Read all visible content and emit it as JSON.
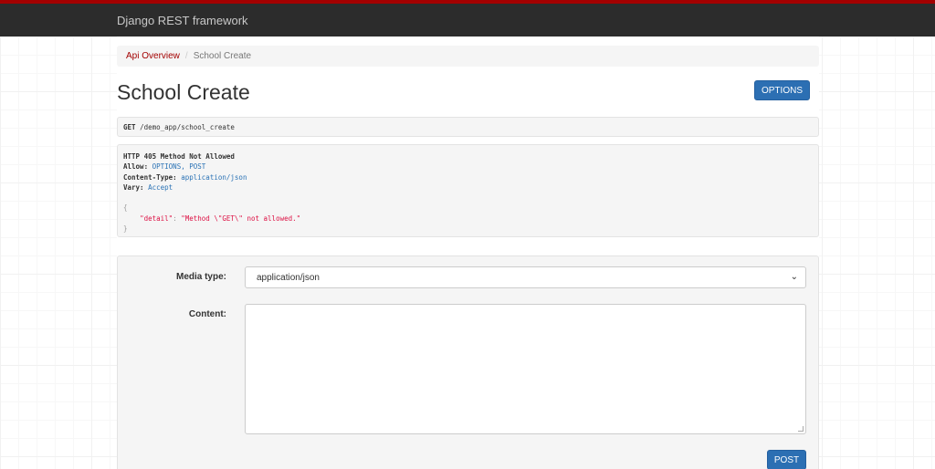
{
  "navbar": {
    "brand": "Django REST framework"
  },
  "breadcrumb": {
    "items": [
      "Api Overview",
      "School Create"
    ],
    "separator": "/"
  },
  "page": {
    "title": "School Create",
    "options_label": "OPTIONS"
  },
  "request": {
    "method": "GET",
    "path": "/demo_app/school_create"
  },
  "response": {
    "status": "HTTP 405 Method Not Allowed",
    "headers": [
      {
        "name": "Allow:",
        "value": "OPTIONS, POST"
      },
      {
        "name": "Content-Type:",
        "value": "application/json"
      },
      {
        "name": "Vary:",
        "value": "Accept"
      }
    ],
    "body": {
      "open": "{",
      "key": "\"detail\"",
      "colon": ":",
      "value": "\"Method \\\"GET\\\" not allowed.\"",
      "close": "}"
    }
  },
  "form": {
    "media_type_label": "Media type:",
    "media_type_value": "application/json",
    "content_label": "Content:",
    "content_value": "",
    "post_label": "POST"
  },
  "colors": {
    "brand_red": "#a30000",
    "navbar": "#2c2c2c",
    "primary": "#2c6fb3"
  }
}
